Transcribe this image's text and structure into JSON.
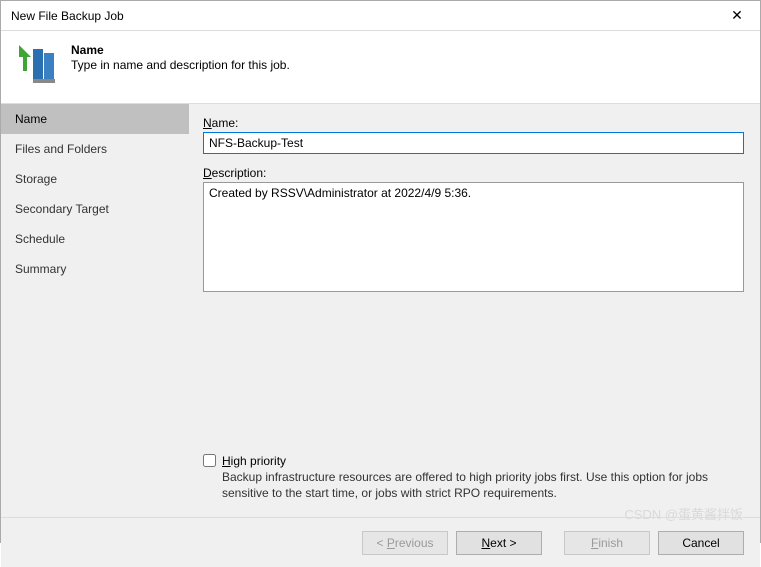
{
  "window": {
    "title": "New File Backup Job",
    "close_glyph": "✕"
  },
  "header": {
    "title": "Name",
    "subtitle": "Type in name and description for this job."
  },
  "sidebar": {
    "items": [
      {
        "label": "Name",
        "active": true
      },
      {
        "label": "Files and Folders",
        "active": false
      },
      {
        "label": "Storage",
        "active": false
      },
      {
        "label": "Secondary Target",
        "active": false
      },
      {
        "label": "Schedule",
        "active": false
      },
      {
        "label": "Summary",
        "active": false
      }
    ]
  },
  "form": {
    "name_label_u": "N",
    "name_label_rest": "ame:",
    "name_value": "NFS-Backup-Test",
    "desc_label_u": "D",
    "desc_label_rest": "escription:",
    "desc_value": "Created by RSSV\\Administrator at 2022/4/9 5:36.",
    "priority_label_u": "H",
    "priority_label_rest": "igh priority",
    "priority_desc": "Backup infrastructure resources are offered to high priority jobs first. Use this option for jobs sensitive to the start time, or jobs with strict RPO requirements."
  },
  "footer": {
    "previous_pre": "< ",
    "previous_u": "P",
    "previous_rest": "revious",
    "next_u": "N",
    "next_rest": "ext >",
    "finish_u": "F",
    "finish_rest": "inish",
    "cancel": "Cancel"
  },
  "watermark": "CSDN @蛋黄酱拌饭"
}
